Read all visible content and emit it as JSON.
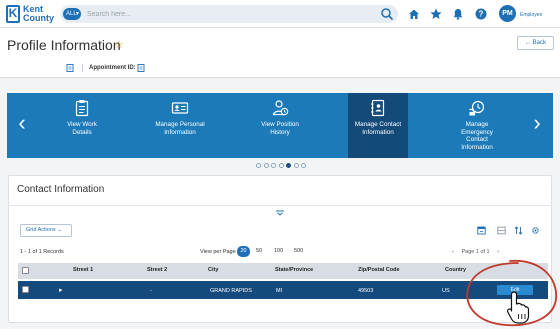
{
  "app": {
    "logo_line1": "Kent",
    "logo_line2": "County",
    "logo_letter": "K",
    "search_scope": "ALL",
    "search_placeholder": "Search here...",
    "user_initials": "PM",
    "user_role": "Employee"
  },
  "header": {
    "title": "Profile Information",
    "back_label": "Back",
    "appointment_label": "Appointment ID:"
  },
  "carousel": {
    "tiles": [
      {
        "label": "View Work\nDetails",
        "icon": "clipboard-icon",
        "active": false
      },
      {
        "label": "Manage Personal\nInformation",
        "icon": "id-card-icon",
        "active": false
      },
      {
        "label": "View Position\nHistory",
        "icon": "position-history-icon",
        "active": false
      },
      {
        "label": "Manage Contact\nInformation",
        "icon": "address-book-icon",
        "active": true
      },
      {
        "label": "Manage\nEmergency\nContact\nInformation",
        "icon": "emergency-contact-icon",
        "active": false
      }
    ],
    "dots": 7,
    "active_dot": 4
  },
  "contact": {
    "title": "Contact Information",
    "grid_actions_label": "Grid Actions",
    "records_label": "1 - 1 of 1 Records",
    "view_per_page_label": "View per Page -",
    "page_sizes": [
      "20",
      "50",
      "100",
      "500"
    ],
    "selected_page_size": "20",
    "pager_text": "Page 1 of 1",
    "columns": [
      "Street 1",
      "Street 2",
      "City",
      "State/Province",
      "Zip/Postal Code",
      "Country"
    ],
    "rows": [
      {
        "street1": "",
        "street2": "-",
        "city": "GRAND RAPIDS",
        "state": "MI",
        "zip": "49503",
        "country": "US",
        "action": "Edit"
      }
    ]
  },
  "colors": {
    "brand": "#1e6fb5",
    "carousel": "#1d7ab8",
    "carousel_active": "#134a7a",
    "row_selected": "#154a7e",
    "annotation": "#c0392b"
  }
}
